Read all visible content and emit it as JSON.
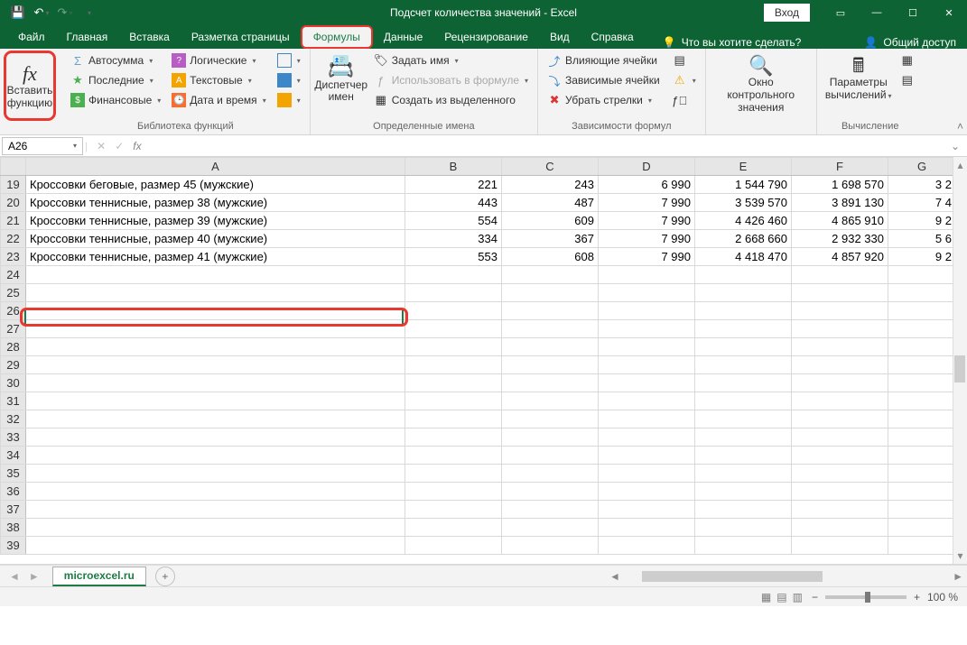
{
  "title": "Подсчет количества значений  -  Excel",
  "login": "Вход",
  "tabs": {
    "file": "Файл",
    "home": "Главная",
    "insert": "Вставка",
    "layout": "Разметка страницы",
    "formulas": "Формулы",
    "data": "Данные",
    "review": "Рецензирование",
    "view": "Вид",
    "help": "Справка",
    "tellme": "Что вы хотите сделать?",
    "share": "Общий доступ"
  },
  "ribbon": {
    "insertfn": {
      "line1": "Вставить",
      "line2": "функцию"
    },
    "lib": {
      "autosum": "Автосумма",
      "recent": "Последние",
      "financial": "Финансовые",
      "logical": "Логические",
      "text": "Текстовые",
      "datetime": "Дата и время",
      "label": "Библиотека функций"
    },
    "lookup": "",
    "math": "",
    "more": "",
    "names": {
      "mgr1": "Диспетчер",
      "mgr2": "имен",
      "define": "Задать имя",
      "usein": "Использовать в формуле",
      "create": "Создать из выделенного",
      "label": "Определенные имена"
    },
    "audit": {
      "precedent": "Влияющие ячейки",
      "dependent": "Зависимые ячейки",
      "remove": "Убрать стрелки",
      "label": "Зависимости формул"
    },
    "watch": {
      "line1": "Окно контрольного",
      "line2": "значения"
    },
    "calc": {
      "line1": "Параметры",
      "line2": "вычислений",
      "label": "Вычисление"
    }
  },
  "namebox": "A26",
  "fx_label": "fx",
  "columns": [
    "A",
    "B",
    "C",
    "D",
    "E",
    "F",
    "G"
  ],
  "rows": [
    {
      "n": 19,
      "a": "Кроссовки беговые, размер 45 (мужские)",
      "b": "221",
      "c": "243",
      "d": "6 990",
      "e": "1 544 790",
      "f": "1 698 570",
      "g": "3 2"
    },
    {
      "n": 20,
      "a": "Кроссовки теннисные, размер 38 (мужские)",
      "b": "443",
      "c": "487",
      "d": "7 990",
      "e": "3 539 570",
      "f": "3 891 130",
      "g": "7 4"
    },
    {
      "n": 21,
      "a": "Кроссовки теннисные, размер 39 (мужские)",
      "b": "554",
      "c": "609",
      "d": "7 990",
      "e": "4 426 460",
      "f": "4 865 910",
      "g": "9 2"
    },
    {
      "n": 22,
      "a": "Кроссовки теннисные, размер 40 (мужские)",
      "b": "334",
      "c": "367",
      "d": "7 990",
      "e": "2 668 660",
      "f": "2 932 330",
      "g": "5 6"
    },
    {
      "n": 23,
      "a": "Кроссовки теннисные, размер 41 (мужские)",
      "b": "553",
      "c": "608",
      "d": "7 990",
      "e": "4 418 470",
      "f": "4 857 920",
      "g": "9 2"
    }
  ],
  "empty_rows": [
    24,
    25,
    26,
    27,
    28,
    29,
    30,
    31,
    32,
    33,
    34,
    35,
    36,
    37,
    38,
    39
  ],
  "selected_row": 26,
  "sheet_name": "microexcel.ru",
  "zoom": "100 %"
}
